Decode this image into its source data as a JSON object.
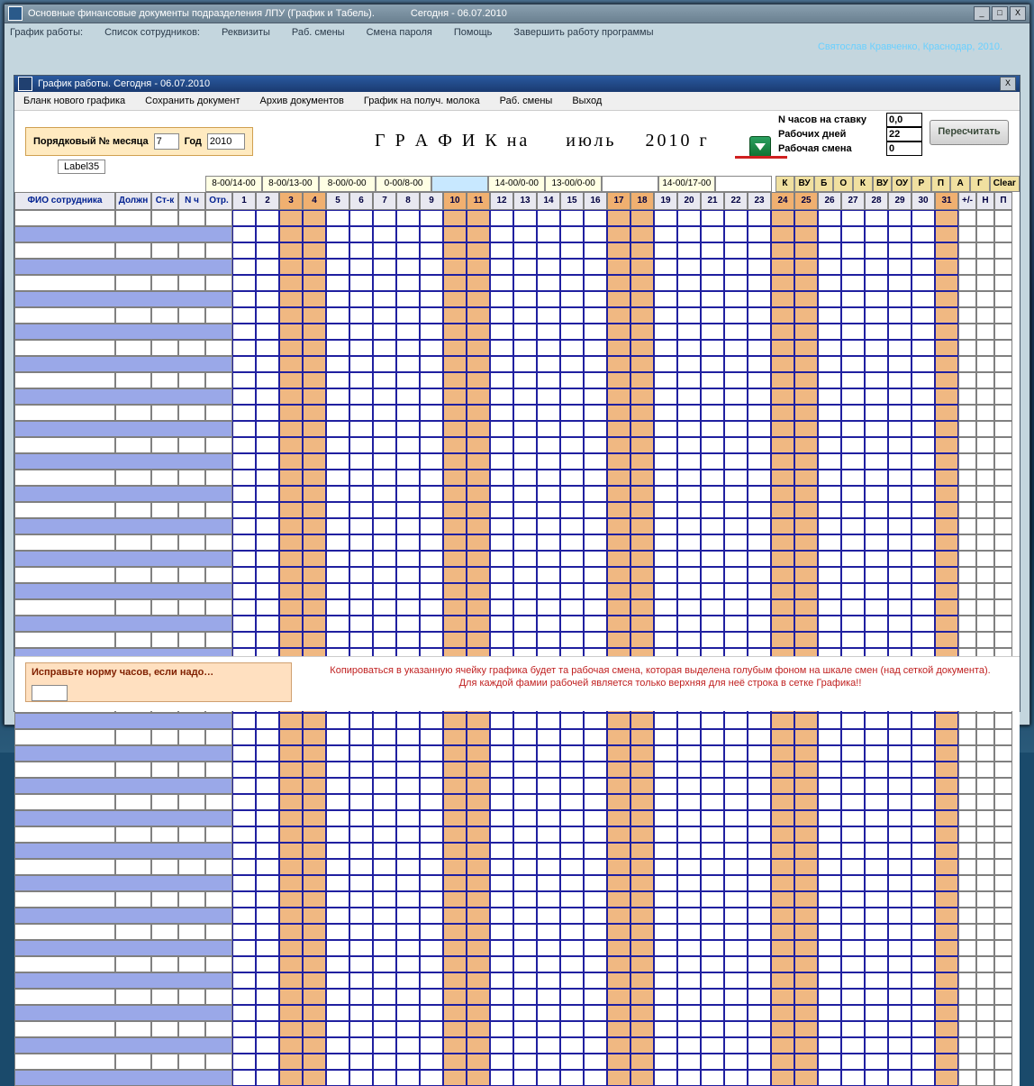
{
  "outer": {
    "title_left": "Основные финансовые документы подразделения  ЛПУ  (График и Табель).",
    "title_right": "Сегодня - 06.07.2010",
    "menu": [
      "График  работы:",
      "Список сотрудников:",
      "Реквизиты",
      "Раб. смены",
      "Смена пароля",
      "Помощь",
      "Завершить работу программы"
    ],
    "credit": "Святослав Кравченко, Краснодар, 2010."
  },
  "inner": {
    "title": "График работы.     Сегодня - 06.07.2010",
    "menu": [
      "Бланк нового графика",
      "Сохранить документ",
      "Архив документов",
      "График на получ. молока",
      "Раб. смены",
      "Выход"
    ]
  },
  "month_box": {
    "label_month": "Порядковый № месяца",
    "month": "7",
    "label_year": "Год",
    "year": "2010"
  },
  "heading": {
    "text_a": "Г Р А Ф И К на",
    "text_b": "июль",
    "text_c": "2010 г"
  },
  "stats": {
    "hours_label": "N часов на ставку",
    "hours": "0,0",
    "days_label": "Рабочих дней",
    "days": "22",
    "shift_label": "Рабочая смена",
    "shift": "0"
  },
  "recalc": "Пересчитать",
  "label35": "Label35",
  "shifts": [
    "8-00/14-00",
    "8-00/13-00",
    "8-00/0-00",
    "0-00/8-00",
    "",
    "14-00/0-00",
    "13-00/0-00",
    "",
    "14-00/17-00",
    ""
  ],
  "shift_selected_index": 4,
  "codes": [
    "К",
    "ВУ",
    "Б",
    "О",
    "К",
    "ВУ",
    "ОУ",
    "Р",
    "П",
    "А",
    "Г",
    "Clear"
  ],
  "columns": {
    "name": "ФИО сотрудника",
    "c1": "Должн",
    "c2": "Ст-к",
    "c3": "N ч",
    "c4": "Отр."
  },
  "extras": [
    "+/-",
    "Н",
    "П"
  ],
  "days": [
    1,
    2,
    3,
    4,
    5,
    6,
    7,
    8,
    9,
    10,
    11,
    12,
    13,
    14,
    15,
    16,
    17,
    18,
    19,
    20,
    21,
    22,
    23,
    24,
    25,
    26,
    27,
    28,
    29,
    30,
    31
  ],
  "weekends": [
    3,
    4,
    10,
    11,
    17,
    18,
    24,
    25,
    31
  ],
  "employee_rows": 27,
  "fix": {
    "label": "Исправьте норму часов, если надо…"
  },
  "hint": {
    "line1": "Копироваться в указанную ячейку графика будет та рабочая смена, которая выделена  голубым фоном на шкале смен (над сеткой документа).",
    "line2": "Для каждой фамии рабочей является только верхняя для неё строка в сетке Графика!!"
  }
}
